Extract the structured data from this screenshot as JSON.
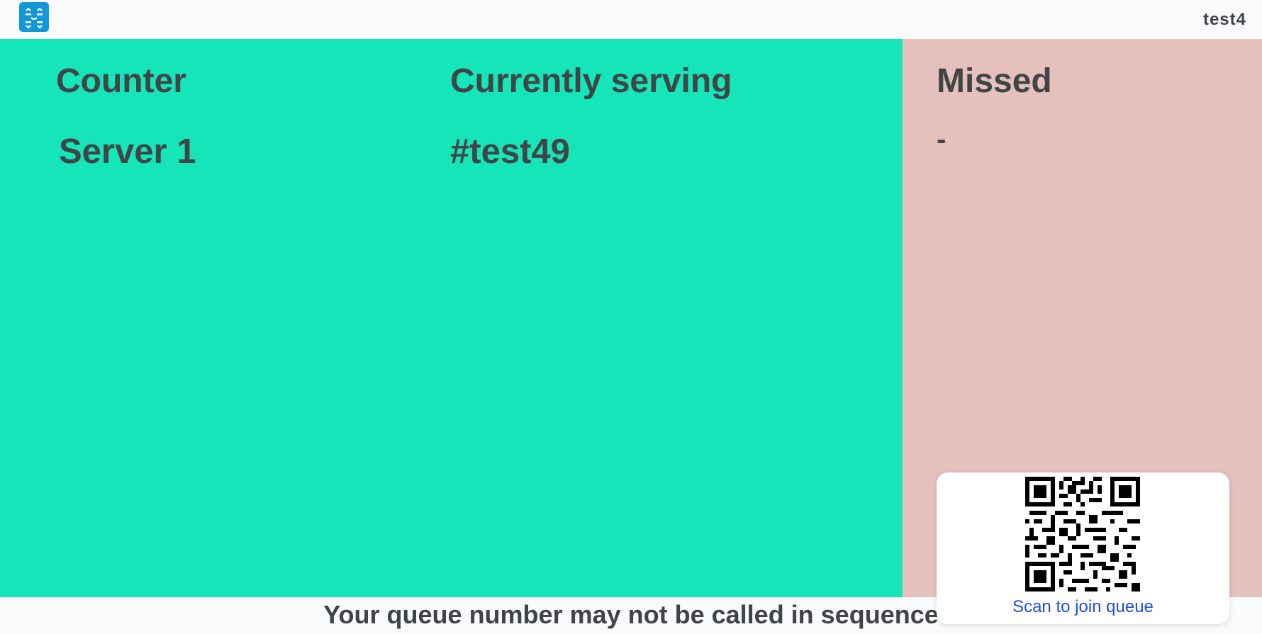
{
  "header": {
    "logo_icon": "queue-app-logo-icon",
    "queue_name": "test4"
  },
  "counter": {
    "heading": "Counter",
    "value": "Server 1"
  },
  "serving": {
    "heading": "Currently serving",
    "value": "#test49"
  },
  "missed": {
    "heading": "Missed",
    "value": "-"
  },
  "qr": {
    "icon": "qr-code-icon",
    "label": "Scan to join queue"
  },
  "footer": {
    "notice": "Your queue number may not be called in sequence"
  },
  "colors": {
    "main_panel": "#16e5b9",
    "missed_panel": "#e5c0bd",
    "logo": "#1497d6",
    "qr_label": "#1d4ed8"
  }
}
